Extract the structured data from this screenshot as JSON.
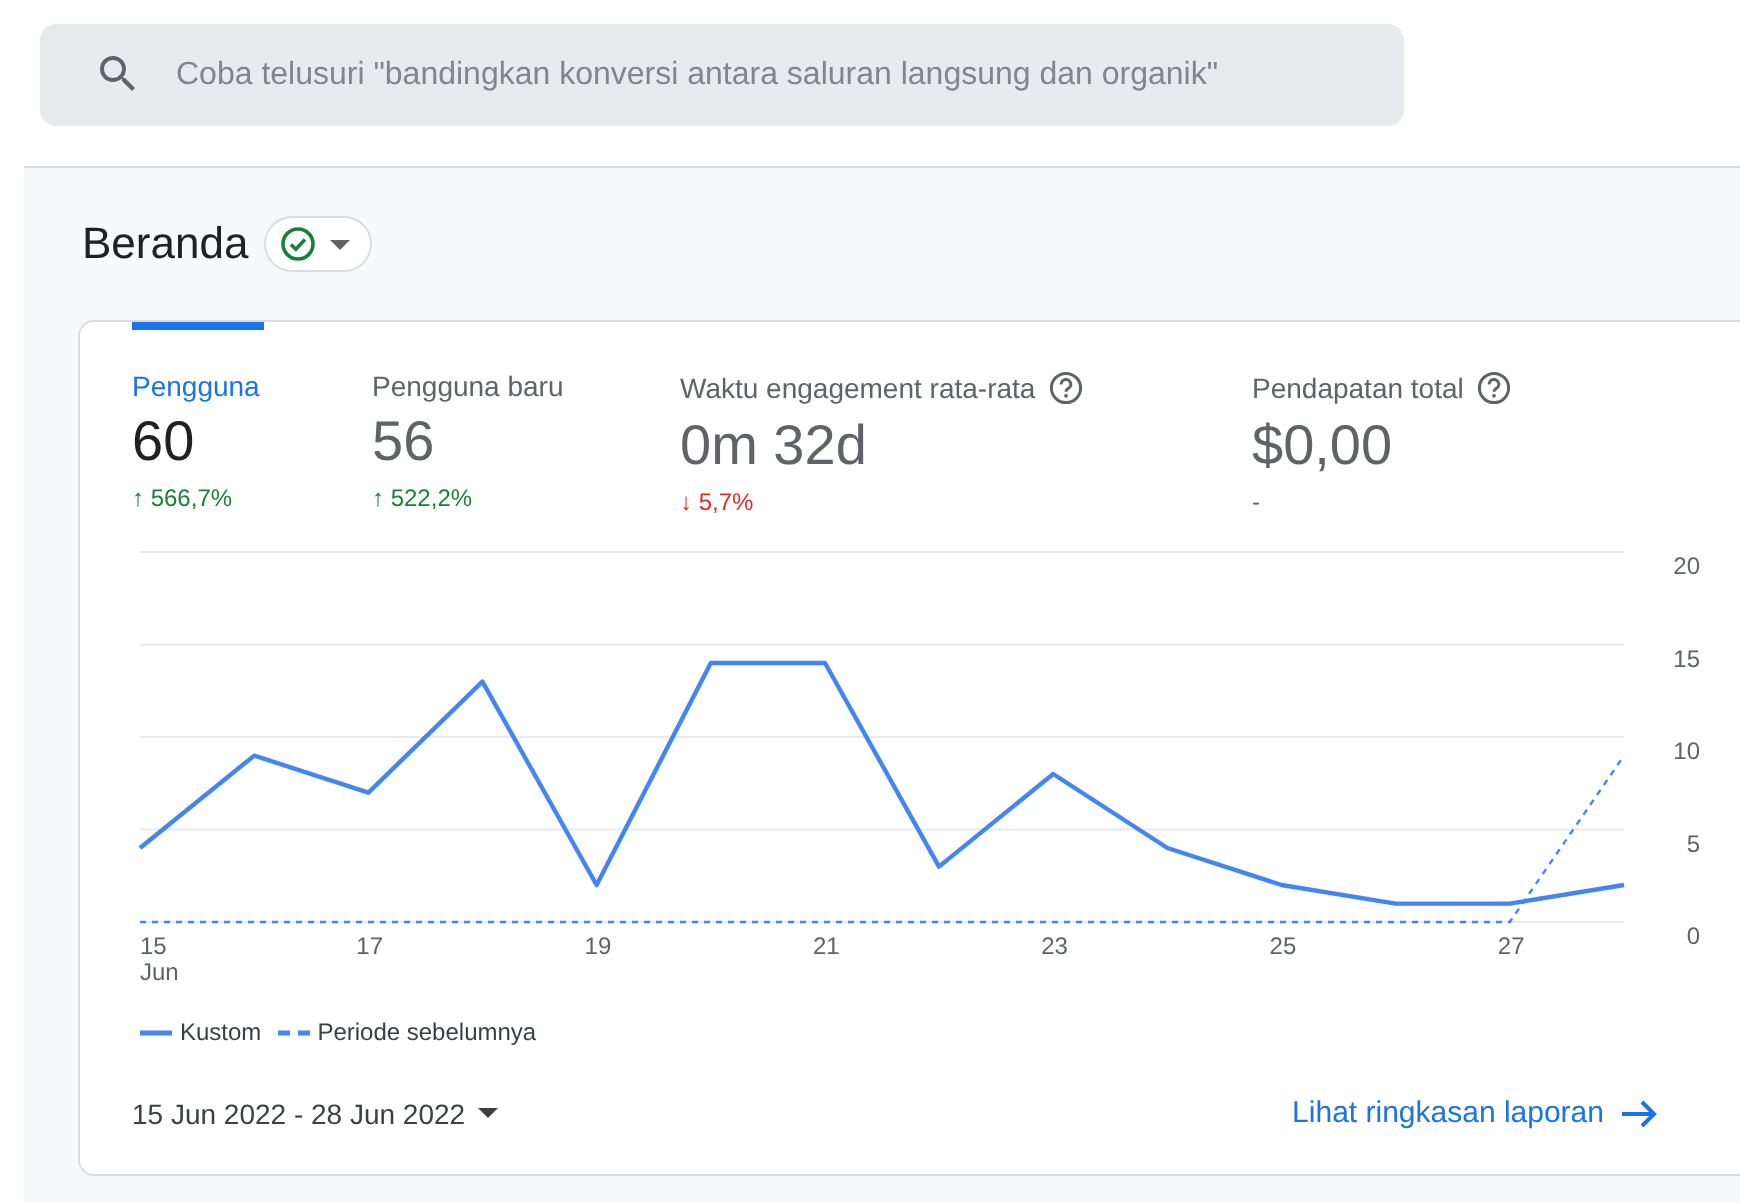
{
  "search": {
    "placeholder": "Coba telusuri \"bandingkan konversi antara saluran langsung dan organik\""
  },
  "page_title": "Beranda",
  "metrics": [
    {
      "label": "Pengguna",
      "value": "60",
      "change": "↑ 566,7%",
      "color": "#188038",
      "help_icon": false,
      "selected": true
    },
    {
      "label": "Pengguna baru",
      "value": "56",
      "change": "↑ 522,2%",
      "color": "#188038",
      "help_icon": false,
      "selected": false
    },
    {
      "label": "Waktu engagement rata-rata",
      "value": "0m 32d",
      "change": "↓ 5,7%",
      "color": "#d93025",
      "help_icon": true,
      "selected": false
    },
    {
      "label": "Pendapatan total",
      "value": "$0,00",
      "change": "-",
      "color": "#5f6368",
      "help_icon": true,
      "selected": false
    }
  ],
  "chart_data": {
    "type": "line",
    "x": [
      15,
      16,
      17,
      18,
      19,
      20,
      21,
      22,
      23,
      24,
      25,
      26,
      27,
      28
    ],
    "series": [
      {
        "name": "Kustom",
        "color": "#4285f4",
        "line_style": "solid",
        "values": [
          4,
          9,
          7,
          13,
          2,
          14,
          14,
          3,
          8,
          4,
          2,
          1,
          1,
          2
        ]
      },
      {
        "name": "Periode sebelumnya",
        "color": "#4285f4",
        "line_style": "dashed",
        "values": [
          0,
          0,
          0,
          0,
          0,
          0,
          0,
          0,
          0,
          0,
          0,
          0,
          0,
          9
        ]
      }
    ],
    "xlim": [
      15,
      28
    ],
    "ylim": [
      0,
      20
    ],
    "grid": true,
    "xticks": [
      {
        "value": 15,
        "label": "15 Jun"
      },
      {
        "value": 17,
        "label": "17"
      },
      {
        "value": 19,
        "label": "19"
      },
      {
        "value": 21,
        "label": "21"
      },
      {
        "value": 23,
        "label": "23"
      },
      {
        "value": 25,
        "label": "25"
      },
      {
        "value": 27,
        "label": "27"
      }
    ],
    "yticks": [
      0,
      5,
      10,
      15,
      20
    ]
  },
  "date_range": "15 Jun 2022 - 28 Jun 2022",
  "report_link": "Lihat ringkasan laporan"
}
